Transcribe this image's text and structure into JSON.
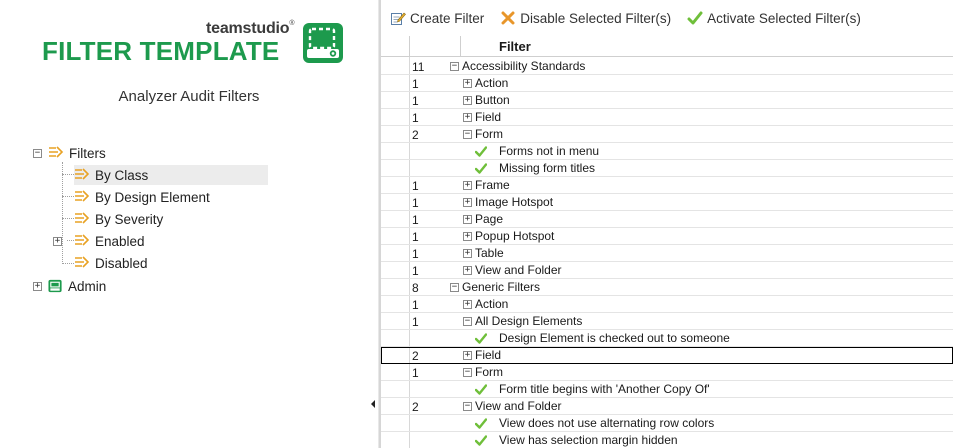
{
  "brand": {
    "company": "teamstudio",
    "trademark": "®",
    "product": "FILTER TEMPLATE",
    "subtitle": "Analyzer Audit Filters",
    "accent_color": "#1d9a4d",
    "icon": "filter-template-logo-icon"
  },
  "tree": {
    "root": {
      "label": "Filters",
      "expanded": true,
      "icon": "filter-icon"
    },
    "children": [
      {
        "label": "By Class",
        "selected": true,
        "icon": "filter-icon"
      },
      {
        "label": "By Design Element",
        "icon": "filter-icon"
      },
      {
        "label": "By Severity",
        "icon": "filter-icon"
      },
      {
        "label": "Enabled",
        "expandable": true,
        "icon": "filter-icon"
      },
      {
        "label": "Disabled",
        "icon": "filter-icon"
      }
    ],
    "admin": {
      "label": "Admin",
      "expandable": true,
      "icon": "admin-icon"
    }
  },
  "toolbar": {
    "create": "Create Filter",
    "disable": "Disable Selected Filter(s)",
    "activate": "Activate Selected Filter(s)"
  },
  "grid": {
    "header": "Filter",
    "rows": [
      {
        "count": "11",
        "level": 0,
        "toggle": "minus",
        "label": "Accessibility Standards"
      },
      {
        "count": "1",
        "level": 1,
        "toggle": "plus",
        "label": "Action"
      },
      {
        "count": "1",
        "level": 1,
        "toggle": "plus",
        "label": "Button"
      },
      {
        "count": "1",
        "level": 1,
        "toggle": "plus",
        "label": "Field"
      },
      {
        "count": "2",
        "level": 1,
        "toggle": "minus",
        "label": "Form"
      },
      {
        "count": "",
        "level": 2,
        "toggle": "check",
        "label": "Forms not in menu"
      },
      {
        "count": "",
        "level": 2,
        "toggle": "check",
        "label": "Missing form titles"
      },
      {
        "count": "1",
        "level": 1,
        "toggle": "plus",
        "label": "Frame"
      },
      {
        "count": "1",
        "level": 1,
        "toggle": "plus",
        "label": "Image Hotspot"
      },
      {
        "count": "1",
        "level": 1,
        "toggle": "plus",
        "label": "Page"
      },
      {
        "count": "1",
        "level": 1,
        "toggle": "plus",
        "label": "Popup Hotspot"
      },
      {
        "count": "1",
        "level": 1,
        "toggle": "plus",
        "label": "Table"
      },
      {
        "count": "1",
        "level": 1,
        "toggle": "plus",
        "label": "View and Folder"
      },
      {
        "count": "8",
        "level": 0,
        "toggle": "minus",
        "label": "Generic Filters"
      },
      {
        "count": "1",
        "level": 1,
        "toggle": "plus",
        "label": "Action"
      },
      {
        "count": "1",
        "level": 1,
        "toggle": "minus",
        "label": "All Design Elements"
      },
      {
        "count": "",
        "level": 2,
        "toggle": "check",
        "label": "Design Element is checked out to someone"
      },
      {
        "count": "2",
        "level": 1,
        "toggle": "plus",
        "label": "Field",
        "focused": true
      },
      {
        "count": "1",
        "level": 1,
        "toggle": "minus",
        "label": "Form"
      },
      {
        "count": "",
        "level": 2,
        "toggle": "check",
        "label": "Form title begins with 'Another Copy Of'"
      },
      {
        "count": "2",
        "level": 1,
        "toggle": "minus",
        "label": "View and Folder"
      },
      {
        "count": "",
        "level": 2,
        "toggle": "check",
        "label": "View does not use alternating row colors"
      },
      {
        "count": "",
        "level": 2,
        "toggle": "check",
        "label": "View has selection margin hidden"
      }
    ]
  },
  "colors": {
    "check_green": "#6fbf3a",
    "filter_orange": "#e8a224",
    "selection_bg": "#ececec"
  }
}
